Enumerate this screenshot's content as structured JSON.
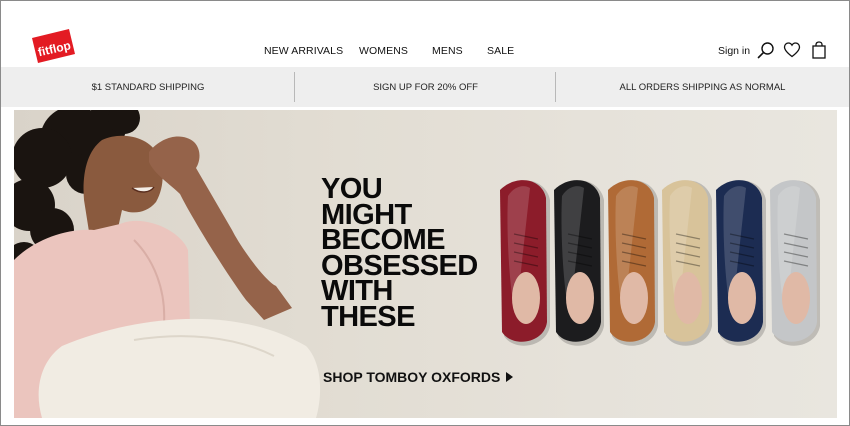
{
  "brand": {
    "logo_text": "fitflop",
    "logo_color": "#e31b23"
  },
  "nav": {
    "items": [
      {
        "label": "NEW ARRIVALS"
      },
      {
        "label": "WOMENS"
      },
      {
        "label": "MENS"
      },
      {
        "label": "SALE"
      }
    ],
    "signin_label": "Sign in",
    "icons": [
      "search-icon",
      "heart-icon",
      "shopping-bag-icon"
    ]
  },
  "promo": {
    "items": [
      {
        "label": "$1 STANDARD SHIPPING"
      },
      {
        "label": "SIGN UP FOR 20% OFF"
      },
      {
        "label": "ALL ORDERS SHIPPING AS NORMAL"
      }
    ]
  },
  "hero": {
    "headline_lines": [
      "YOU",
      "MIGHT",
      "BECOME",
      "OBSESSED",
      "WITH",
      "THESE"
    ],
    "cta_label": "SHOP TOMBOY OXFORDS",
    "shoe_colors": [
      "#8c1c2a",
      "#1c1c1e",
      "#b06a36",
      "#d8c39a",
      "#1c2c52",
      "#c4c6c8"
    ]
  },
  "colors": {
    "promo_bg": "#eeeeee",
    "text": "#111111"
  }
}
